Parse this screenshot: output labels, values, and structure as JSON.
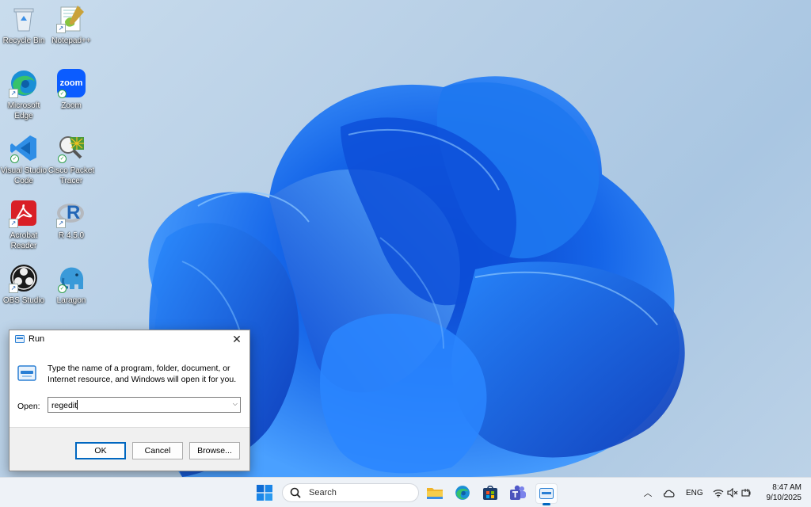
{
  "desktop_icons": [
    {
      "label": "Recycle Bin",
      "icon": "recycle-bin-icon"
    },
    {
      "label": "Notepad++",
      "icon": "notepadpp-icon"
    },
    {
      "label": "Microsoft Edge",
      "icon": "edge-icon"
    },
    {
      "label": "Zoom",
      "icon": "zoom-icon",
      "badge_text": "zoom"
    },
    {
      "label": "Visual Studio Code",
      "icon": "vscode-icon"
    },
    {
      "label": "Cisco Packet Tracer",
      "icon": "packet-tracer-icon"
    },
    {
      "label": "Acrobat Reader",
      "icon": "acrobat-icon"
    },
    {
      "label": "R 4.5.0",
      "icon": "r-icon",
      "badge_text": "R"
    },
    {
      "label": "OBS Studio",
      "icon": "obs-icon"
    },
    {
      "label": "Laragon",
      "icon": "laragon-icon"
    }
  ],
  "run_dialog": {
    "title": "Run",
    "description": "Type the name of a program, folder, document, or Internet resource, and Windows will open it for you.",
    "open_label": "Open:",
    "open_value": "regedit",
    "ok_label": "OK",
    "cancel_label": "Cancel",
    "browse_label": "Browse..."
  },
  "taskbar": {
    "search_placeholder": "Search",
    "pinned": [
      "start-icon",
      "file-explorer-icon",
      "edge-icon",
      "store-icon",
      "teams-icon",
      "run-icon"
    ],
    "language": "ENG",
    "time": "8:47 AM",
    "date": "9/10/2025"
  },
  "colors": {
    "accent": "#0067c0",
    "bloom_blue": "#1565e8",
    "taskbar_bg": "#eef2f7"
  }
}
